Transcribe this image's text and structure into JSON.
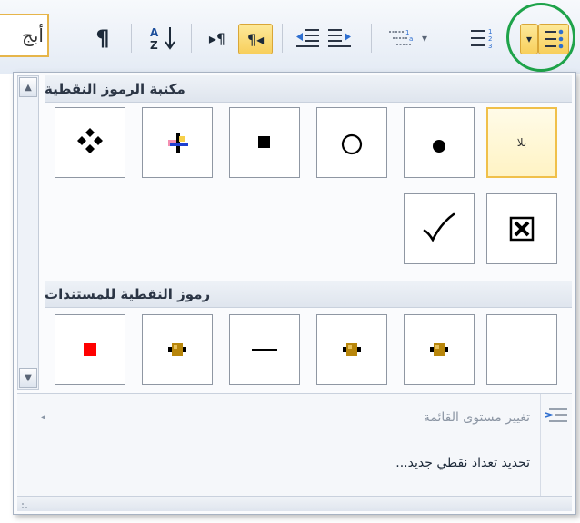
{
  "toolbar": {
    "font_box_text": "أبج",
    "pilcrow": "¶",
    "sort_az": "A↓Z",
    "ltr_symbol": "▸¶",
    "rtl_symbol": "¶◂",
    "indent_decrease": "⇤",
    "indent_increase": "⇥",
    "multilevel_symbol": "1.a.i",
    "numbering_symbol": "1≡",
    "bullets_symbol": "•≡",
    "dropdown_arrow": "▾"
  },
  "panel": {
    "library_title": "مكتبة الرموز النقطية",
    "document_title": "رموز النقطية للمستندات",
    "none_label": "بلا",
    "menu": {
      "change_level": "تغيير مستوى القائمة",
      "define_new": "تحديد تعداد نقطي جديد..."
    },
    "scroll_up": "▲",
    "scroll_down": "▼"
  },
  "colors": {
    "selected_border": "#f0c04a",
    "accent_green": "#1ea34a",
    "red_square": "#ff0000",
    "gold_bullet": "#b8860b"
  }
}
